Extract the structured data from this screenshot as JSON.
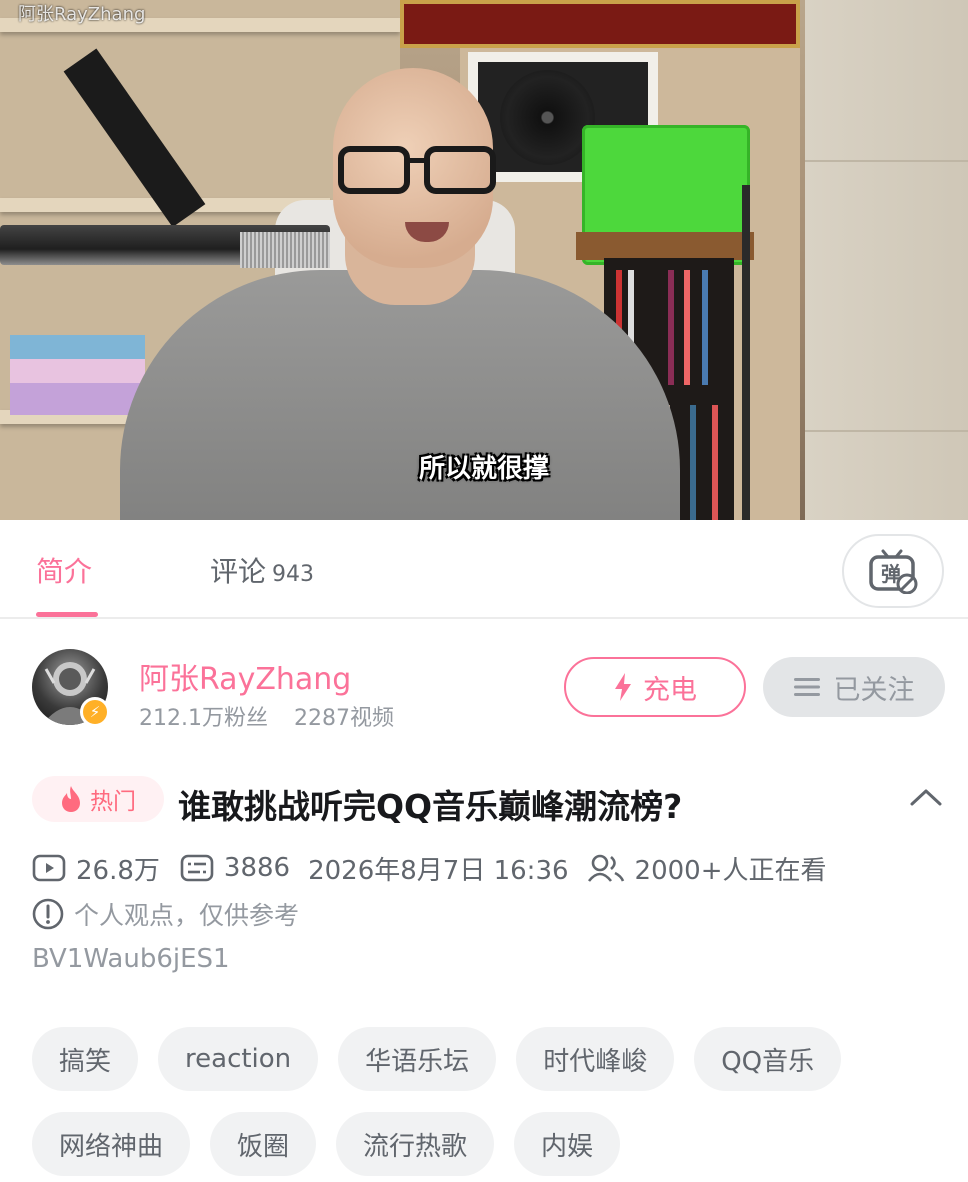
{
  "video": {
    "watermark": "阿张RayZhang",
    "subtitle": "所以就很撑"
  },
  "tabs": {
    "intro_label": "简介",
    "comments_label": "评论",
    "comments_count": "943",
    "danmaku_icon_glyph": "弹"
  },
  "uploader": {
    "name": "阿张RayZhang",
    "fans": "212.1万粉丝",
    "videos": "2287视频",
    "charge_label": "充电",
    "follow_label": "已关注"
  },
  "title": {
    "badge": "热门",
    "text": "谁敢挑战听完QQ音乐巅峰潮流榜?"
  },
  "meta": {
    "views": "26.8万",
    "danmaku": "3886",
    "datetime": "2026年8月7日 16:36",
    "watching": "2000+人正在看",
    "notice": "个人观点，仅供参考",
    "bvid": "BV1Waub6jES1"
  },
  "tags": [
    "搞笑",
    "reaction",
    "华语乐坛",
    "时代峰峻",
    "QQ音乐",
    "网络神曲",
    "饭圈",
    "流行热歌",
    "内娱"
  ],
  "colors": {
    "accent": "#fb7299",
    "hot": "#ff6b7f",
    "text_secondary": "#61666d",
    "text_tertiary": "#9499a0"
  }
}
